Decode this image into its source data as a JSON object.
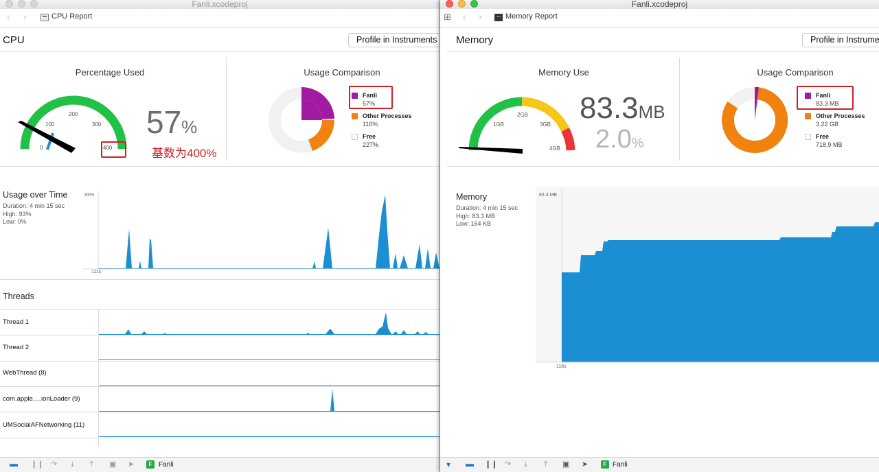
{
  "left_window": {
    "title": "Fanli.xcodeproj",
    "breadcrumb": "CPU Report",
    "section_title": "CPU",
    "profile_button": "Profile in Instruments",
    "gauge": {
      "title": "Percentage Used",
      "ticks": [
        "0",
        "100",
        "200",
        "300",
        "400"
      ],
      "value": "57",
      "unit": "%",
      "annotation": "基数为400%"
    },
    "usage_comparison": {
      "title": "Usage Comparison",
      "legend": [
        {
          "name": "Fanli",
          "value": "57%",
          "color": "#a21aa1"
        },
        {
          "name": "Other Processes",
          "value": "116%",
          "color": "#f0820f"
        },
        {
          "name": "Free",
          "value": "227%",
          "color": "#f1f1f1"
        }
      ]
    },
    "usage_over_time": {
      "title": "Usage over Time",
      "duration": "Duration: 4 min 15 sec",
      "high": "High: 93%",
      "low": "Low: 0%",
      "y_label": "93%",
      "x_label": "111s"
    },
    "threads_title": "Threads",
    "threads": [
      {
        "name": "Thread 1"
      },
      {
        "name": "Thread 2"
      },
      {
        "name": "WebThread (8)"
      },
      {
        "name": "com.apple.…ionLoader (9)"
      },
      {
        "name": "UMSocialAFNetworking (11)"
      }
    ],
    "bottom_app": "Fanli"
  },
  "right_window": {
    "title": "Fanli.xcodeproj",
    "breadcrumb": "Memory Report",
    "section_title": "Memory",
    "profile_button": "Profile in Instruments",
    "gauge": {
      "title": "Memory Use",
      "ticks": [
        "1GB",
        "2GB",
        "3GB",
        "4GB"
      ],
      "value": "83.3",
      "unit": "MB",
      "secondary_value": "2.0",
      "secondary_unit": "%"
    },
    "usage_comparison": {
      "title": "Usage Comparison",
      "legend": [
        {
          "name": "Fanli",
          "value": "83.3 MB",
          "color": "#a21aa1"
        },
        {
          "name": "Other Processes",
          "value": "3.22 GB",
          "color": "#f0820f"
        },
        {
          "name": "Free",
          "value": "718.9 MB",
          "color": "#f1f1f1"
        }
      ]
    },
    "memory_chart": {
      "title": "Memory",
      "duration": "Duration: 4 min 15 sec",
      "high": "High: 83.3 MB",
      "low": "Low: 164 KB",
      "y_label": "83.3 MB",
      "x_label": "116s"
    },
    "bottom_app": "Fanli"
  },
  "colors": {
    "accent_blue": "#1b8fd2",
    "gauge_green": "#22c145",
    "gauge_yellow": "#f6c71b",
    "gauge_red": "#e8363a",
    "annotation_red": "#d01f23"
  },
  "icons": [
    "back-arrow-icon",
    "forward-arrow-icon",
    "grid-icon",
    "pause-icon",
    "step-over-icon",
    "step-in-icon",
    "step-out-icon",
    "location-icon",
    "breakpoint-icon",
    "view-debugger-icon"
  ]
}
